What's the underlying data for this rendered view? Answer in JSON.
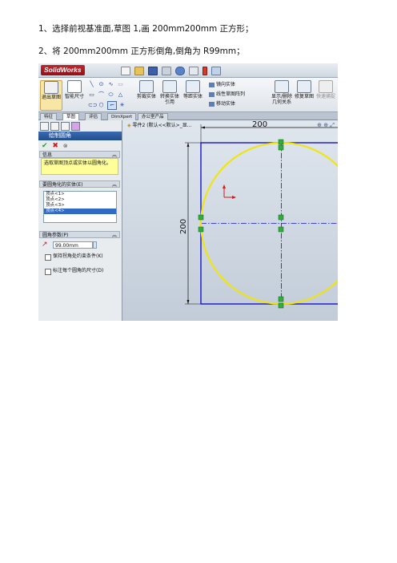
{
  "doc": {
    "line1": "1、选择前视基准面,草图 1,画 200mm200mm 正方形；",
    "line2": "2、将 200mm200mm 正方形倒角,倒角为 R99mm；"
  },
  "app": {
    "logo": "SolidWorks",
    "ribbon": {
      "exit_sketch": "退出草图",
      "smart_dimension": "智能尺寸",
      "trim_entities": "剪裁实体",
      "convert_entities": "转换实体引用",
      "offset_entities": "等距实体",
      "mirror_entities": "镜向实体",
      "linear_pattern": "线性草图阵列",
      "move_entities": "移动实体",
      "display_delete_relations": "显示/删除几何关系",
      "repair_sketch": "修复草图",
      "quick_snaps": "快速捕捉"
    },
    "tabs": [
      "特征",
      "草图",
      "评估",
      "DimXpert",
      "办公室产品"
    ],
    "active_tab": "草图",
    "property_manager": {
      "title": "绘制圆角",
      "message_head": "信息",
      "message": "选取草图顶点或实体以圆角化。",
      "entities_head": "要圆角化的实体(E)",
      "entities": [
        "顶点<1>",
        "顶点<2>",
        "顶点<3>",
        "顶点<4>"
      ],
      "params_head": "圆角参数(P)",
      "radius_value": "99.00mm",
      "option1": "保持拐角处约束条件(K)",
      "option2": "标注每个圆角的尺寸(D)"
    },
    "canvas": {
      "tree_path": "零件2  (默认<<默认>_显...",
      "dim_horizontal": "200",
      "dim_vertical": "200"
    }
  }
}
